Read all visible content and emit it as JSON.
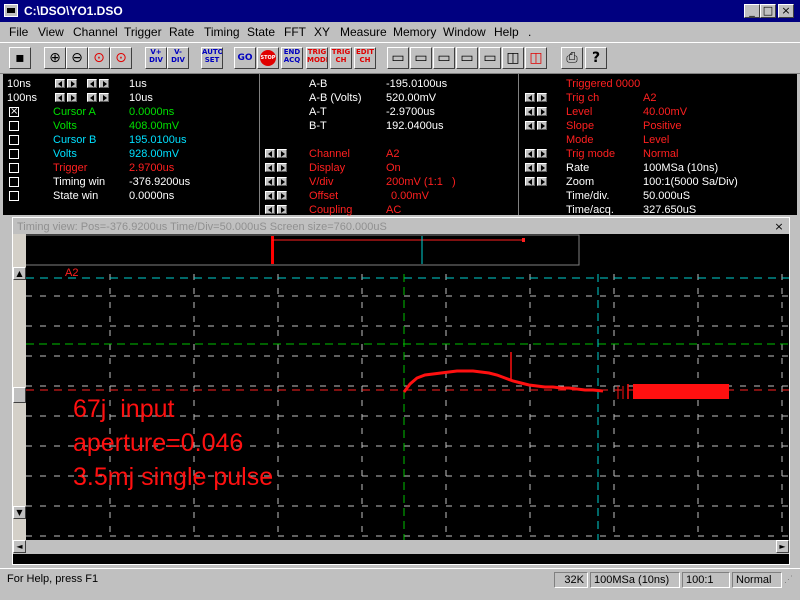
{
  "window": {
    "title": "C:\\DSO\\YO1.DSO",
    "min_glyph": "_",
    "max_glyph": "□",
    "close_glyph": "×"
  },
  "menu": [
    "File",
    "View",
    "Channel",
    "Trigger",
    "Rate",
    "Timing",
    "State",
    "FFT",
    "XY",
    "Measure",
    "Memory",
    "Window",
    "Help",
    "."
  ],
  "toolbar": {
    "auto_set": "AUTO SET",
    "go": "GO",
    "stop": "STOP",
    "end_acq": "END ACQ",
    "trig_mode": "TRIG MODE",
    "trig_ch": "TRIG CH",
    "edit_ch": "EDIT CH",
    "v_plus_div": "V+ DIV",
    "v_minus_div": "V- DIV",
    "help_glyph": "?"
  },
  "panel_left": {
    "row1_left": "10ns",
    "row1_right": "1us",
    "row2_left": "100ns",
    "row2_right": "10us",
    "cursor_a_label": "Cursor A",
    "cursor_a_value": "0.0000ns",
    "volts_a_label": "Volts",
    "volts_a_value": "408.00mV",
    "cursor_b_label": "Cursor B",
    "cursor_b_value": "195.0100us",
    "volts_b_label": "Volts",
    "volts_b_value": "928.00mV",
    "trigger_label": "Trigger",
    "trigger_value": "2.9700us",
    "timing_win_label": "Timing win",
    "timing_win_value": "-376.9200us",
    "state_win_label": "State win",
    "state_win_value": "0.0000ns",
    "check_glyph": "×"
  },
  "panel_mid": {
    "ab_label": "A-B",
    "ab_value": "-195.0100us",
    "ab_volts_label": "A-B (Volts)",
    "ab_volts_value": "520.00mV",
    "at_label": "A-T",
    "at_value": "-2.9700us",
    "bt_label": "B-T",
    "bt_value": "192.0400us",
    "channel_label": "Channel",
    "channel_value": "A2",
    "display_label": "Display",
    "display_value": "On",
    "vdiv_label": "V/div",
    "vdiv_value": "200mV (1:1   )",
    "offset_label": "Offset",
    "offset_value": "0.00mV",
    "coupling_label": "Coupling",
    "coupling_value": "AC"
  },
  "panel_right": {
    "triggered": "Triggered 0000",
    "trig_ch_label": "Trig ch",
    "trig_ch_value": "A2",
    "level_label": "Level",
    "level_value": "40.00mV",
    "slope_label": "Slope",
    "slope_value": "Positive",
    "mode_label": "Mode",
    "mode_value": "Level",
    "trig_mode_label": "Trig mode",
    "trig_mode_value": "Normal",
    "rate_label": "Rate",
    "rate_value": "100MSa (10ns)",
    "zoom_label": "Zoom",
    "zoom_value": "100:1(5000 Sa/Div)",
    "time_div_label": "Time/div.",
    "time_div_value": "50.000uS",
    "time_acq_label": "Time/acq.",
    "time_acq_value": "327.650uS"
  },
  "timing_view": {
    "caption": "Timing view: Pos=-376.9200us Time/Div=50.000uS Screen size=760.000uS",
    "close_glyph": "×",
    "channel_tag": "A2",
    "annotation_line1": "67j  input",
    "annotation_line2": "aperture=0.046",
    "annotation_line3": "3.5mj single pulse",
    "scroll_up": "▲",
    "scroll_down": "▼",
    "scroll_left": "◄",
    "scroll_right": "►"
  },
  "colors": {
    "trace": "#ff1010",
    "grid": "#c0c0c0",
    "cursor_a": "#00c000",
    "cursor_b": "#00d0d0",
    "title_bar": "#000080"
  },
  "status": {
    "help_text": "For Help, press F1",
    "memory": "32K",
    "rate": "100MSa (10ns)",
    "zoom": "100:1",
    "mode": "Normal"
  }
}
